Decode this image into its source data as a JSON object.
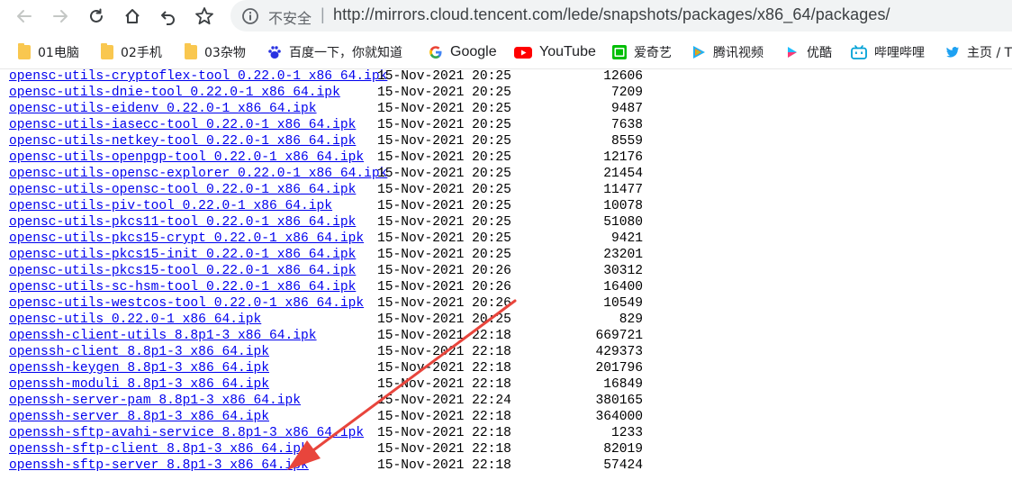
{
  "browser": {
    "back_icon": "arrow-left-icon",
    "forward_icon": "arrow-right-icon",
    "reload_icon": "reload-icon",
    "home_icon": "home-icon",
    "undo_icon": "undo-icon",
    "star_icon": "star-icon",
    "security_label": "不安全",
    "separator": "|",
    "url": "http://mirrors.cloud.tencent.com/lede/snapshots/packages/x86_64/packages/"
  },
  "bookmarks": [
    {
      "label": "01电脑",
      "icon": "folder-icon"
    },
    {
      "label": "02手机",
      "icon": "folder-icon"
    },
    {
      "label": "03杂物",
      "icon": "folder-icon"
    },
    {
      "label": "百度一下，你就知道",
      "icon": "baidu-icon"
    },
    {
      "label": "Google",
      "icon": "google-icon"
    },
    {
      "label": "YouTube",
      "icon": "youtube-icon"
    },
    {
      "label": "爱奇艺",
      "icon": "iqiyi-icon"
    },
    {
      "label": "腾讯视频",
      "icon": "tencent-video-icon"
    },
    {
      "label": "优酷",
      "icon": "youku-icon"
    },
    {
      "label": "哔哩哔哩",
      "icon": "bilibili-icon"
    },
    {
      "label": "主页 / T",
      "icon": "twitter-icon"
    }
  ],
  "files": [
    {
      "name": "opensc-utils-cryptoflex-tool_0.22.0-1_x86_64.ipk",
      "date": "15-Nov-2021 20:25",
      "size": "12606"
    },
    {
      "name": "opensc-utils-dnie-tool_0.22.0-1_x86_64.ipk",
      "date": "15-Nov-2021 20:25",
      "size": "7209"
    },
    {
      "name": "opensc-utils-eidenv_0.22.0-1_x86_64.ipk",
      "date": "15-Nov-2021 20:25",
      "size": "9487"
    },
    {
      "name": "opensc-utils-iasecc-tool_0.22.0-1_x86_64.ipk",
      "date": "15-Nov-2021 20:25",
      "size": "7638"
    },
    {
      "name": "opensc-utils-netkey-tool_0.22.0-1_x86_64.ipk",
      "date": "15-Nov-2021 20:25",
      "size": "8559"
    },
    {
      "name": "opensc-utils-openpgp-tool_0.22.0-1_x86_64.ipk",
      "date": "15-Nov-2021 20:25",
      "size": "12176"
    },
    {
      "name": "opensc-utils-opensc-explorer_0.22.0-1_x86_64.ipk",
      "date": "15-Nov-2021 20:25",
      "size": "21454"
    },
    {
      "name": "opensc-utils-opensc-tool_0.22.0-1_x86_64.ipk",
      "date": "15-Nov-2021 20:25",
      "size": "11477"
    },
    {
      "name": "opensc-utils-piv-tool_0.22.0-1_x86_64.ipk",
      "date": "15-Nov-2021 20:25",
      "size": "10078"
    },
    {
      "name": "opensc-utils-pkcs11-tool_0.22.0-1_x86_64.ipk",
      "date": "15-Nov-2021 20:25",
      "size": "51080"
    },
    {
      "name": "opensc-utils-pkcs15-crypt_0.22.0-1_x86_64.ipk",
      "date": "15-Nov-2021 20:25",
      "size": "9421"
    },
    {
      "name": "opensc-utils-pkcs15-init_0.22.0-1_x86_64.ipk",
      "date": "15-Nov-2021 20:25",
      "size": "23201"
    },
    {
      "name": "opensc-utils-pkcs15-tool_0.22.0-1_x86_64.ipk",
      "date": "15-Nov-2021 20:26",
      "size": "30312"
    },
    {
      "name": "opensc-utils-sc-hsm-tool_0.22.0-1_x86_64.ipk",
      "date": "15-Nov-2021 20:26",
      "size": "16400"
    },
    {
      "name": "opensc-utils-westcos-tool_0.22.0-1_x86_64.ipk",
      "date": "15-Nov-2021 20:26",
      "size": "10549"
    },
    {
      "name": "opensc-utils_0.22.0-1_x86_64.ipk",
      "date": "15-Nov-2021 20:25",
      "size": "829"
    },
    {
      "name": "openssh-client-utils_8.8p1-3_x86_64.ipk",
      "date": "15-Nov-2021 22:18",
      "size": "669721"
    },
    {
      "name": "openssh-client_8.8p1-3_x86_64.ipk",
      "date": "15-Nov-2021 22:18",
      "size": "429373"
    },
    {
      "name": "openssh-keygen_8.8p1-3_x86_64.ipk",
      "date": "15-Nov-2021 22:18",
      "size": "201796"
    },
    {
      "name": "openssh-moduli_8.8p1-3_x86_64.ipk",
      "date": "15-Nov-2021 22:18",
      "size": "16849"
    },
    {
      "name": "openssh-server-pam_8.8p1-3_x86_64.ipk",
      "date": "15-Nov-2021 22:24",
      "size": "380165"
    },
    {
      "name": "openssh-server_8.8p1-3_x86_64.ipk",
      "date": "15-Nov-2021 22:18",
      "size": "364000"
    },
    {
      "name": "openssh-sftp-avahi-service_8.8p1-3_x86_64.ipk",
      "date": "15-Nov-2021 22:18",
      "size": "1233"
    },
    {
      "name": "openssh-sftp-client_8.8p1-3_x86_64.ipk",
      "date": "15-Nov-2021 22:18",
      "size": "82019"
    },
    {
      "name": "openssh-sftp-server_8.8p1-3_x86_64.ipk",
      "date": "15-Nov-2021 22:18",
      "size": "57424"
    }
  ],
  "annotation": {
    "arrow_color": "#e8453c",
    "arrow_icon": "red-arrow-annotation",
    "points_to": "openssh-sftp-server_8.8p1-3_x86_64.ipk"
  }
}
